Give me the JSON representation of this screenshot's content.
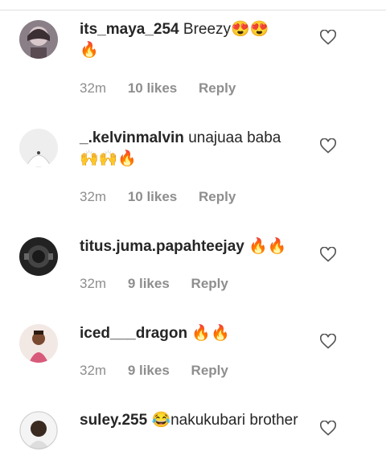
{
  "comments": [
    {
      "username": "its_maya_254",
      "text": "Breezy😍😍\n🔥",
      "time": "32m",
      "likes": "10 likes",
      "reply": "Reply"
    },
    {
      "username": "_.kelvinmalvin",
      "text": "unajuaa baba\n🙌🙌🔥",
      "time": "32m",
      "likes": "10 likes",
      "reply": "Reply"
    },
    {
      "username": "titus.juma.papahteejay",
      "text": "🔥🔥",
      "time": "32m",
      "likes": "9 likes",
      "reply": "Reply"
    },
    {
      "username": "iced___dragon",
      "text": "🔥🔥",
      "time": "32m",
      "likes": "9 likes",
      "reply": "Reply"
    },
    {
      "username": "suley.255",
      "text": "😂nakukubari brother"
    }
  ],
  "icons": {
    "like": "heart-outline-icon"
  },
  "colors": {
    "username": "#262626",
    "meta": "#8e8e8e",
    "background": "#ffffff"
  }
}
